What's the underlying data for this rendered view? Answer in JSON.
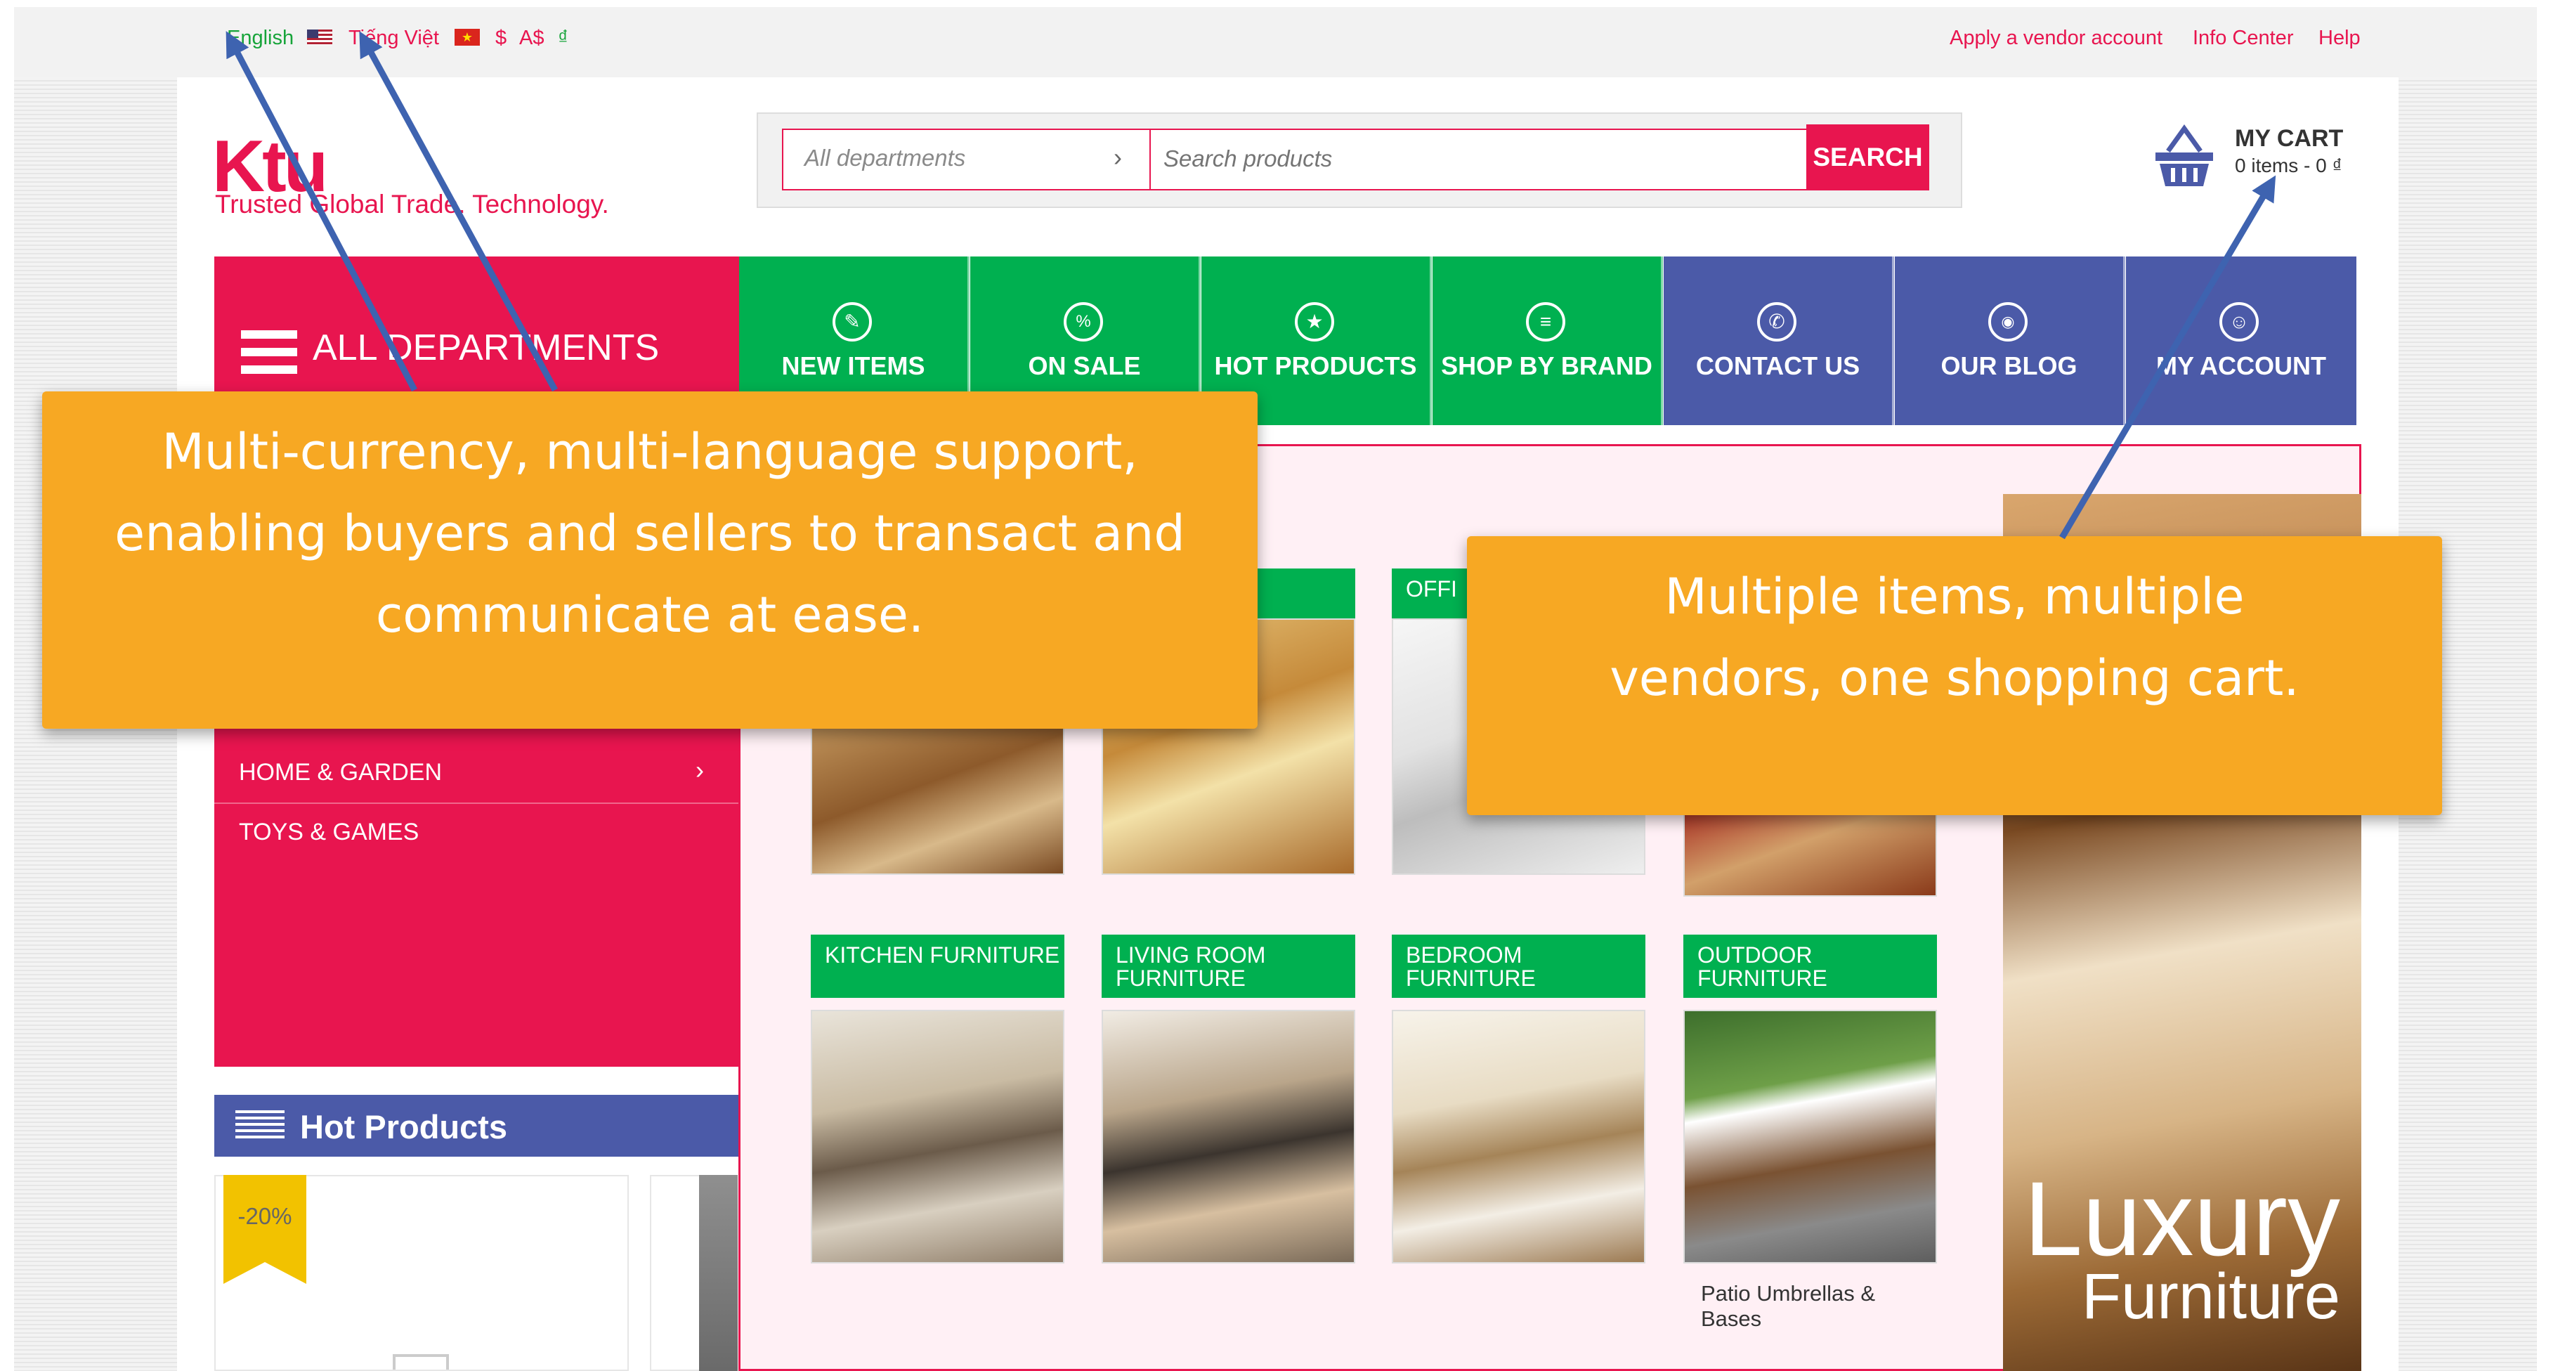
{
  "topbar": {
    "languages": [
      "English",
      "Tiếng Việt"
    ],
    "currencies": [
      "$",
      "A$",
      "₫"
    ],
    "right_links": [
      "Apply a vendor account",
      "Info Center",
      "Help"
    ]
  },
  "brand": {
    "logo": "Ktu",
    "tagline": "Trusted Global Trade. Technology."
  },
  "search": {
    "department": "All departments",
    "placeholder": "Search products",
    "button": "SEARCH"
  },
  "cart": {
    "title": "MY CART",
    "summary": "0 items - 0 ₫"
  },
  "nav": {
    "all_departments": "ALL DEPARTMENTS",
    "items": [
      {
        "label": "NEW ITEMS",
        "icon": "tag-icon"
      },
      {
        "label": "ON SALE",
        "icon": "percent-icon"
      },
      {
        "label": "HOT PRODUCTS",
        "icon": "star-icon"
      },
      {
        "label": "SHOP BY BRAND",
        "icon": "list-icon"
      },
      {
        "label": "CONTACT US",
        "icon": "phone-icon"
      },
      {
        "label": "OUR BLOG",
        "icon": "rss-icon"
      },
      {
        "label": "MY ACCOUNT",
        "icon": "user-icon"
      }
    ]
  },
  "sidebar": {
    "items": [
      "HOME & GARDEN",
      "TOYS & GAMES"
    ]
  },
  "hot_products": {
    "title": "Hot Products",
    "badge": "-20%"
  },
  "categories": {
    "top_partial": "OFFI",
    "bottom": [
      "KITCHEN FURNITURE",
      "LIVING ROOM FURNITURE",
      "BEDROOM FURNITURE",
      "OUTDOOR FURNITURE"
    ],
    "caption": "Patio Umbrellas & Bases"
  },
  "banner": {
    "line1": "Luxury",
    "line2": "Furniture"
  },
  "callouts": {
    "left": "Multi-currency, multi-language support, enabling buyers and sellers to transact and communicate at ease.",
    "right": "Multiple items, multiple vendors, one shopping cart."
  },
  "colors": {
    "brand_red": "#e8154f",
    "nav_green": "#00b050",
    "nav_blue": "#4b5aa8",
    "callout_orange": "#f7a823"
  }
}
